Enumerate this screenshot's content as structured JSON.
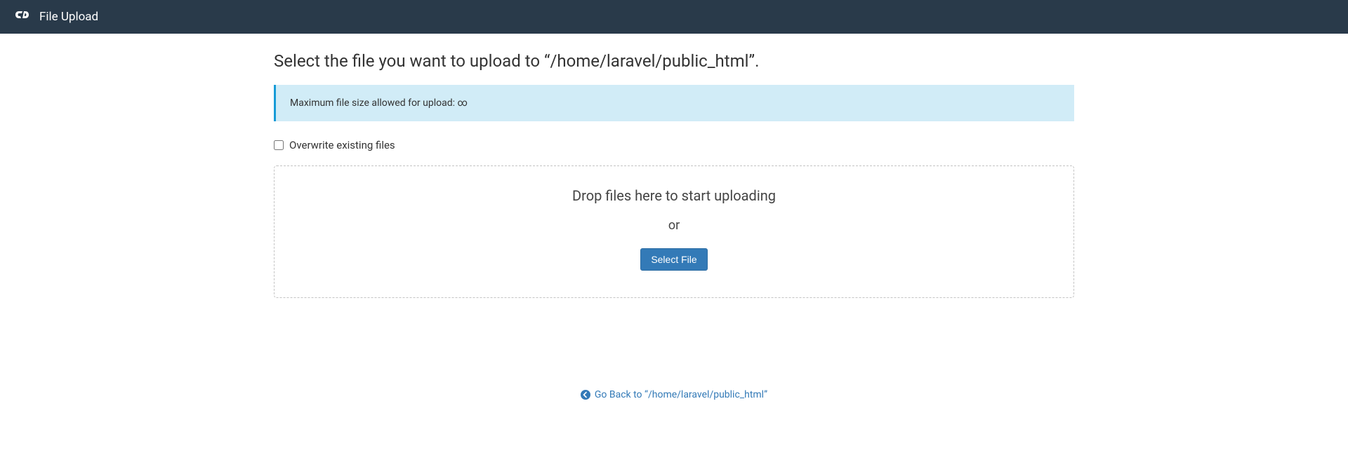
{
  "header": {
    "title": "File Upload"
  },
  "main": {
    "heading": "Select the file you want to upload to “/home/laravel/public_html”.",
    "info_message": "Maximum file size allowed for upload: ∞",
    "overwrite_label": "Overwrite existing files",
    "dropzone_text": "Drop files here to start uploading",
    "dropzone_or": "or",
    "select_file_label": "Select File",
    "go_back_label": "Go Back to “/home/laravel/public_html”"
  }
}
